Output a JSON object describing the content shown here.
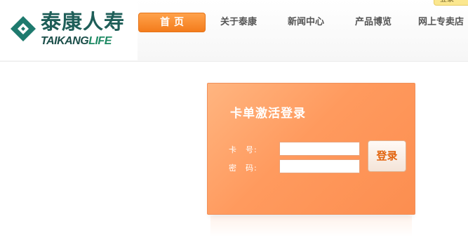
{
  "brand": {
    "name_cn": "泰康人寿",
    "name_en_part1": "TAIKANG",
    "name_en_part2": "LIFE",
    "logo_color": "#1e7a6e"
  },
  "top_badge": {
    "label": "登录"
  },
  "nav": {
    "home": "首页",
    "items": [
      "关于泰康",
      "新闻中心",
      "产品博览",
      "网上专卖店"
    ]
  },
  "login": {
    "title": "卡单激活登录",
    "card_label": "卡　号:",
    "password_label": "密　码:",
    "card_value": "",
    "password_value": "",
    "submit_label": "登录",
    "accent": "#ff9a5e"
  }
}
